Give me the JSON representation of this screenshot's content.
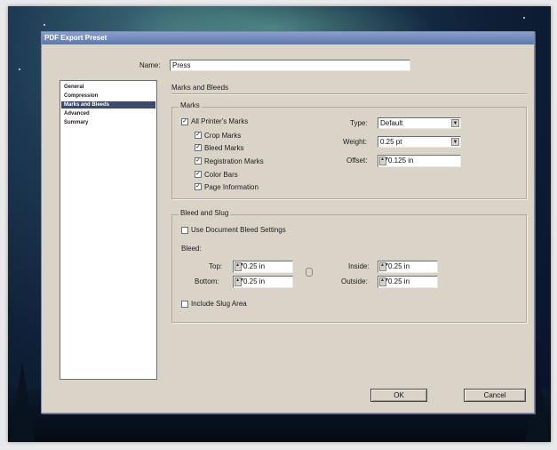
{
  "window": {
    "title": "PDF Export Preset"
  },
  "name_field": {
    "label": "Name:",
    "value": "Press"
  },
  "sidebar": {
    "items": [
      {
        "label": "General",
        "selected": false
      },
      {
        "label": "Compression",
        "selected": false
      },
      {
        "label": "Marks and Bleeds",
        "selected": true
      },
      {
        "label": "Advanced",
        "selected": false
      },
      {
        "label": "Summary",
        "selected": false
      }
    ]
  },
  "section": {
    "title": "Marks and Bleeds"
  },
  "marks": {
    "group_title": "Marks",
    "all_printers_marks": {
      "label": "All Printer's Marks",
      "checked": true
    },
    "items": [
      {
        "label": "Crop Marks",
        "checked": true
      },
      {
        "label": "Bleed Marks",
        "checked": true
      },
      {
        "label": "Registration Marks",
        "checked": true
      },
      {
        "label": "Color Bars",
        "checked": true
      },
      {
        "label": "Page Information",
        "checked": true
      }
    ],
    "type": {
      "label": "Type:",
      "value": "Default"
    },
    "weight": {
      "label": "Weight:",
      "value": "0.25 pt"
    },
    "offset": {
      "label": "Offset:",
      "value": "0.125 in"
    }
  },
  "bleed_slug": {
    "group_title": "Bleed and Slug",
    "use_document_bleed": {
      "label": "Use Document Bleed Settings",
      "checked": false
    },
    "bleed_label": "Bleed:",
    "top": {
      "label": "Top:",
      "value": "0.25 in"
    },
    "bottom": {
      "label": "Bottom:",
      "value": "0.25 in"
    },
    "inside": {
      "label": "Inside:",
      "value": "0.25 in"
    },
    "outside": {
      "label": "Outside:",
      "value": "0.25 in"
    },
    "include_slug": {
      "label": "Include Slug Area",
      "checked": false
    }
  },
  "buttons": {
    "ok": "OK",
    "cancel": "Cancel"
  },
  "glyphs": {
    "check": "✓",
    "dropdown": "▼",
    "spin": "▲▼"
  },
  "colors": {
    "title_bar": "#5e78b0",
    "dialog_bg": "#d9d3c8",
    "selection": "#3e4a6b"
  }
}
